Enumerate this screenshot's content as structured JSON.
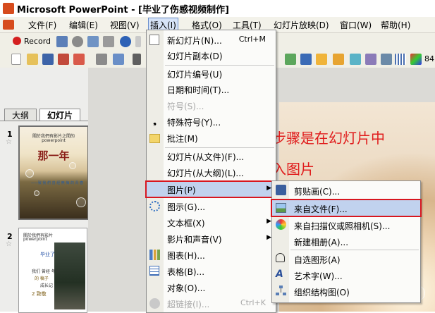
{
  "window": {
    "title": "Microsoft PowerPoint - [毕业了伤感视频制作]"
  },
  "menubar": {
    "items": [
      {
        "label": "文件(F)"
      },
      {
        "label": "编辑(E)"
      },
      {
        "label": "视图(V)"
      },
      {
        "label": "插入(I)"
      },
      {
        "label": "格式(O)"
      },
      {
        "label": "工具(T)"
      },
      {
        "label": "幻灯片放映(D)"
      },
      {
        "label": "窗口(W)"
      },
      {
        "label": "帮助(H)"
      }
    ],
    "active": "插入(I)"
  },
  "toolbar": {
    "record_label": "Record",
    "zoom": "84"
  },
  "left_panel": {
    "tabs": [
      {
        "label": "大纲"
      },
      {
        "label": "幻灯片"
      }
    ],
    "selected_tab": "幻灯片",
    "slides": [
      {
        "number": "1",
        "title_small": "關於我們有影片之間的",
        "title_small2": "powerpoint",
        "heading": "那一年",
        "subtitle": "——致 我 們 曾 經 無 悔 的 青 春"
      },
      {
        "number": "2",
        "line1": "關於我們有影片",
        "line2": "powerpoint",
        "line3": "毕业了",
        "line4": "我们 曾经 年华",
        "line5": "的 稿子",
        "line6": "成长记",
        "line7": "2 致敬"
      }
    ]
  },
  "insert_menu": {
    "items": [
      {
        "label": "新幻灯片(N)...",
        "shortcut": "Ctrl+M"
      },
      {
        "label": "幻灯片副本(D)"
      },
      {
        "label": "幻灯片编号(U)"
      },
      {
        "label": "日期和时间(T)..."
      },
      {
        "label": "符号(S)...",
        "disabled": true
      },
      {
        "label": "特殊符号(Y)..."
      },
      {
        "label": "批注(M)"
      },
      {
        "label": "幻灯片(从文件)(F)..."
      },
      {
        "label": "幻灯片(从大纲)(L)..."
      },
      {
        "label": "图片(P)"
      },
      {
        "label": "图示(G)..."
      },
      {
        "label": "文本框(X)"
      },
      {
        "label": "影片和声音(V)"
      },
      {
        "label": "图表(H)..."
      },
      {
        "label": "表格(B)..."
      },
      {
        "label": "对象(O)..."
      },
      {
        "label": "超链接(I)...",
        "shortcut": "Ctrl+K",
        "disabled": true
      }
    ],
    "highlighted": "图片(P)"
  },
  "picture_submenu": {
    "items": [
      {
        "label": "剪贴画(C)..."
      },
      {
        "label": "来自文件(F)..."
      },
      {
        "label": "来自扫描仪或照相机(S)..."
      },
      {
        "label": "新建相册(A)..."
      },
      {
        "label": "自选图形(A)"
      },
      {
        "label": "艺术字(W)..."
      },
      {
        "label": "组织结构图(O)"
      }
    ],
    "highlighted": "来自文件(F)..."
  },
  "annotation": {
    "line1": "此步骤是在幻灯片中",
    "line2": "插入图片",
    "color": "#e01b1b"
  },
  "colors": {
    "highlight": "#c1d2ee",
    "outline_red": "#d8161f"
  }
}
